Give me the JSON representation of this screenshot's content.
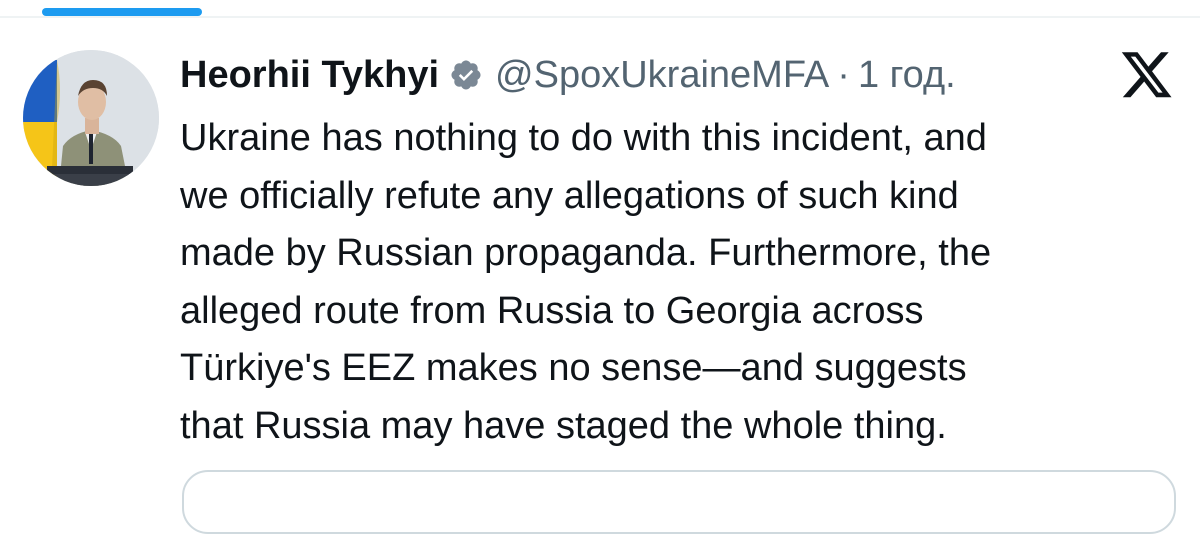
{
  "author": {
    "display_name": "Heorhii Tykhyi",
    "handle": "@SpoxUkraineMFA",
    "separator": "·",
    "timestamp": "1 год.",
    "verified": true
  },
  "icons": {
    "verified": "verified-badge-icon",
    "platform": "x-logo-icon"
  },
  "colors": {
    "accent": "#1d9bf0",
    "text_primary": "#0f1419",
    "text_secondary": "#536471",
    "verified_badge": "#7b8895"
  },
  "tweet": {
    "lines": [
      "Ukraine has nothing to do with this incident, and",
      "we officially refute any allegations of such kind",
      "made by Russian propaganda. Furthermore, the",
      "alleged route from Russia to Georgia across",
      "Türkiye's EEZ makes no sense—and suggests",
      "that Russia may have staged the whole thing."
    ]
  }
}
